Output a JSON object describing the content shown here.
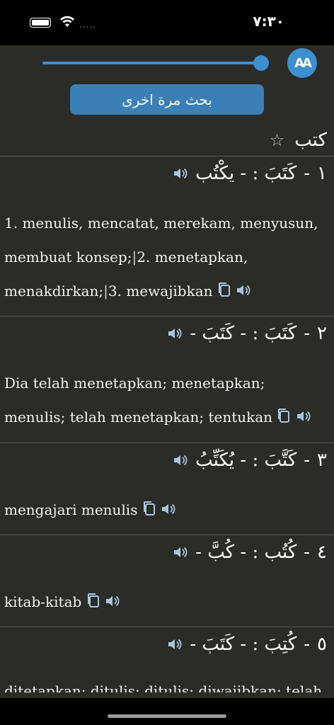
{
  "status": {
    "time": "٧:٣٠",
    "dots": "....."
  },
  "toolbar": {
    "font_button": "AA",
    "search_again": "بحث مرة اخرى",
    "slider_level_percent": 100
  },
  "word": {
    "title": "كتب",
    "star": "☆"
  },
  "entries": [
    {
      "num": "١",
      "forms": "كَتَبَ : - يكْتُب",
      "meaning_parts": [
        "1. menulis, mencatat, merekam, menyusun, membuat konsep;",
        "2. menetapkan, menakdirkan;",
        "3. mewajibkan"
      ]
    },
    {
      "num": "٢",
      "forms": "كَتَبَ : - كَتَبَ -",
      "meaning": "Dia telah menetapkan; menetapkan; menulis; telah menetapkan; tentukan"
    },
    {
      "num": "٣",
      "forms": "كَتَّبَ : - يُكَتِّبُ",
      "meaning": "mengajari menulis"
    },
    {
      "num": "٤",
      "forms": "كُتُب : - كُبَّ -",
      "meaning": "kitab-kitab"
    },
    {
      "num": "٥",
      "forms": "كُتِبَ : - كَتَبَ -",
      "meaning": "ditetapkan; ditulis; ditulis; diwajibkan; telah"
    }
  ],
  "dash": "-",
  "icons": {
    "speaker": "speaker-icon",
    "copy": "copy-icon",
    "star": "star-icon",
    "wifi": "wifi-icon",
    "battery": "battery-icon"
  },
  "colors": {
    "accent": "#3d8fd0",
    "button": "#3b7fb7",
    "background": "#2b2b28",
    "icon": "#a9c6dc"
  }
}
